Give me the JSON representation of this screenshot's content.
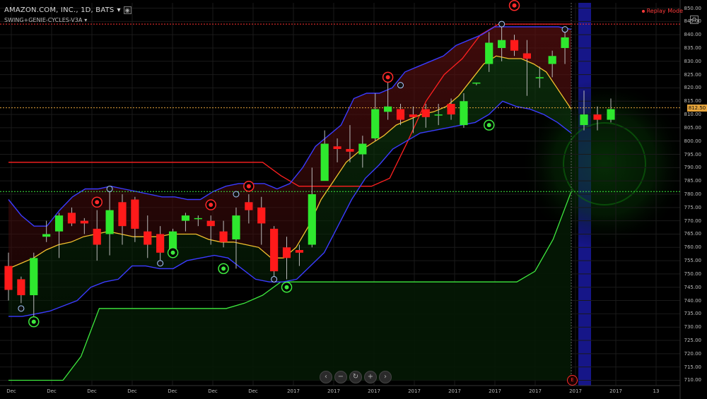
{
  "header": {
    "symbol_title": "AMAZON.COM, INC., 1D, BATS",
    "dropdown_arrow": "▾",
    "indicator_name": "SWING+GENIE-CYCLES-V3A",
    "replay_mode": "Replay Mode"
  },
  "colors": {
    "up_candle": "#2ee82e",
    "down_candle": "#ff1a1a",
    "upper_band": "#3b3bff",
    "midline": "#f2c12e",
    "red_line": "#ff2020",
    "green_line": "#3ee83e",
    "highlight_column": "#1a1aa0",
    "last_price_tag": "#e4a33a"
  },
  "icons": {
    "settings": "gear-icon",
    "eye": "eye-icon",
    "close": "close-icon",
    "nav_prev": "chevron-left-icon",
    "nav_zoom_out": "minus-icon",
    "nav_reset": "reset-icon",
    "nav_zoom_in": "plus-icon",
    "nav_next": "chevron-right-icon"
  },
  "nav_symbols": {
    "prev": "‹",
    "zoom_out": "−",
    "reset": "↻",
    "zoom_in": "+",
    "next": "›"
  },
  "last_price": "812.50",
  "event_marker": "E",
  "y_axis": {
    "labels": [
      "850.00",
      "845.00",
      "840.00",
      "835.00",
      "830.00",
      "825.00",
      "820.00",
      "815.00",
      "810.00",
      "805.00",
      "800.00",
      "795.00",
      "790.00",
      "785.00",
      "780.00",
      "775.00",
      "770.00",
      "765.00",
      "760.00",
      "755.00",
      "750.00",
      "745.00",
      "740.00",
      "735.00",
      "730.00",
      "725.00",
      "720.00",
      "715.00",
      "710.00"
    ],
    "values": [
      850,
      845,
      840,
      835,
      830,
      825,
      820,
      815,
      810,
      805,
      800,
      795,
      790,
      785,
      780,
      775,
      770,
      765,
      760,
      755,
      750,
      745,
      740,
      735,
      730,
      725,
      720,
      715,
      710
    ]
  },
  "x_axis": {
    "labels": [
      "Dec",
      "Dec",
      "Dec",
      "Dec",
      "Dec",
      "Dec",
      "Dec",
      "2017",
      "2017",
      "2017",
      "2017",
      "2017",
      "2017",
      "2017",
      "2017",
      "2017",
      "13"
    ]
  },
  "chart_data": {
    "type": "candlestick",
    "ylim": [
      708,
      852
    ],
    "reference_lines": {
      "red_dotted": 844,
      "green_dotted": 781,
      "orange_dotted": 812.5
    },
    "candles": [
      {
        "o": 753,
        "h": 758,
        "l": 740,
        "c": 744
      },
      {
        "o": 748,
        "h": 749,
        "l": 739,
        "c": 742
      },
      {
        "o": 742,
        "h": 758,
        "l": 732,
        "c": 756
      },
      {
        "o": 764,
        "h": 770,
        "l": 762,
        "c": 765
      },
      {
        "o": 766,
        "h": 773,
        "l": 756,
        "c": 772
      },
      {
        "o": 773,
        "h": 775,
        "l": 768,
        "c": 769
      },
      {
        "o": 770,
        "h": 771,
        "l": 765,
        "c": 769
      },
      {
        "o": 767,
        "h": 774,
        "l": 755,
        "c": 761
      },
      {
        "o": 765,
        "h": 781,
        "l": 757,
        "c": 774
      },
      {
        "o": 777,
        "h": 780,
        "l": 761,
        "c": 768
      },
      {
        "o": 778,
        "h": 779,
        "l": 762,
        "c": 767
      },
      {
        "o": 766,
        "h": 772,
        "l": 756,
        "c": 761
      },
      {
        "o": 765,
        "h": 768,
        "l": 754,
        "c": 758
      },
      {
        "o": 759,
        "h": 767,
        "l": 757,
        "c": 766
      },
      {
        "o": 770,
        "h": 773,
        "l": 766,
        "c": 772
      },
      {
        "o": 771,
        "h": 772,
        "l": 768,
        "c": 771
      },
      {
        "o": 770,
        "h": 772,
        "l": 761,
        "c": 768
      },
      {
        "o": 766,
        "h": 770,
        "l": 760,
        "c": 762
      },
      {
        "o": 763,
        "h": 775,
        "l": 752,
        "c": 772
      },
      {
        "o": 777,
        "h": 780,
        "l": 769,
        "c": 774
      },
      {
        "o": 775,
        "h": 779,
        "l": 761,
        "c": 769
      },
      {
        "o": 767,
        "h": 768,
        "l": 749,
        "c": 751
      },
      {
        "o": 760,
        "h": 764,
        "l": 748,
        "c": 756
      },
      {
        "o": 759,
        "h": 761,
        "l": 753,
        "c": 758
      },
      {
        "o": 761,
        "h": 790,
        "l": 760,
        "c": 780
      },
      {
        "o": 785,
        "h": 804,
        "l": 786,
        "c": 799
      },
      {
        "o": 798,
        "h": 801,
        "l": 792,
        "c": 797
      },
      {
        "o": 797,
        "h": 806,
        "l": 792,
        "c": 796
      },
      {
        "o": 795,
        "h": 802,
        "l": 790,
        "c": 799
      },
      {
        "o": 801,
        "h": 818,
        "l": 800,
        "c": 812
      },
      {
        "o": 811,
        "h": 822,
        "l": 808,
        "c": 813
      },
      {
        "o": 812,
        "h": 814,
        "l": 806,
        "c": 808
      },
      {
        "o": 810,
        "h": 813,
        "l": 803,
        "c": 809
      },
      {
        "o": 812,
        "h": 814,
        "l": 805,
        "c": 809
      },
      {
        "o": 810,
        "h": 814,
        "l": 806,
        "c": 810
      },
      {
        "o": 814,
        "h": 816,
        "l": 808,
        "c": 810
      },
      {
        "o": 806,
        "h": 818,
        "l": 805,
        "c": 815
      },
      {
        "o": 822,
        "h": 822,
        "l": 821,
        "c": 822
      },
      {
        "o": 829,
        "h": 841,
        "l": 826,
        "c": 837
      },
      {
        "o": 835,
        "h": 843,
        "l": 830,
        "c": 838
      },
      {
        "o": 838,
        "h": 840,
        "l": 832,
        "c": 834
      },
      {
        "o": 833,
        "h": 838,
        "l": 817,
        "c": 831
      },
      {
        "o": 824,
        "h": 828,
        "l": 820,
        "c": 824
      },
      {
        "o": 829,
        "h": 834,
        "l": 824,
        "c": 832
      },
      {
        "o": 835,
        "h": 843,
        "l": 829,
        "c": 839
      },
      {
        "o": 806,
        "h": 819,
        "l": 804,
        "c": 810
      },
      {
        "o": 810,
        "h": 813,
        "l": 804,
        "c": 808
      },
      {
        "o": 808,
        "h": 816,
        "l": 807,
        "c": 812
      }
    ],
    "upper_band": [
      778,
      772,
      768,
      768,
      774,
      779,
      782,
      782,
      783,
      782,
      781,
      780,
      779,
      779,
      778,
      778,
      781,
      783,
      784,
      784,
      784,
      782,
      784,
      790,
      798,
      802,
      806,
      816,
      818,
      818,
      820,
      826,
      828,
      830,
      832,
      836,
      838,
      840,
      843,
      843,
      843,
      843,
      843,
      843,
      842
    ],
    "mid_line": [
      752,
      754,
      756,
      759,
      761,
      762,
      764,
      765,
      766,
      765,
      764,
      764,
      764,
      765,
      765,
      765,
      763,
      762,
      762,
      761,
      760,
      756,
      756,
      760,
      768,
      778,
      785,
      792,
      796,
      799,
      802,
      806,
      808,
      810,
      811,
      813,
      817,
      823,
      829,
      832,
      831,
      831,
      829,
      826,
      819,
      812
    ],
    "lower_band": [
      734,
      734,
      735,
      736,
      738,
      740,
      745,
      747,
      748,
      753,
      753,
      752,
      752,
      755,
      756,
      757,
      756,
      752,
      748,
      747,
      747,
      748,
      753,
      758,
      768,
      778,
      786,
      791,
      797,
      800,
      803,
      804,
      805,
      806,
      807,
      810,
      815,
      813,
      812,
      810,
      807,
      803
    ],
    "red_line": [
      792,
      792,
      792,
      792,
      792,
      792,
      792,
      792,
      792,
      792,
      792,
      792,
      792,
      792,
      792,
      787,
      783,
      783,
      783,
      783,
      783,
      786,
      800,
      815,
      825,
      831,
      840,
      844,
      844,
      844,
      844,
      844
    ],
    "green_line": [
      710,
      710,
      710,
      710,
      719,
      737,
      737,
      737,
      737,
      737,
      737,
      737,
      737,
      739,
      742,
      747,
      747,
      747,
      747,
      747,
      747,
      747,
      747,
      747,
      747,
      747,
      747,
      747,
      747,
      751,
      763,
      781
    ]
  }
}
